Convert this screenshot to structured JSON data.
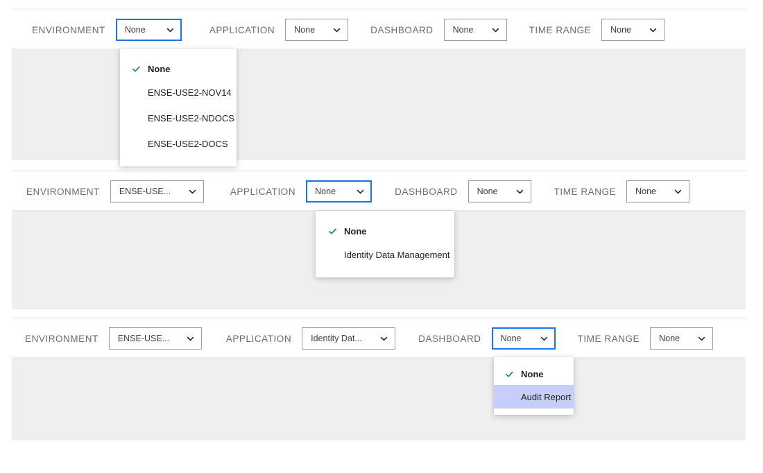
{
  "labels": {
    "environment": "ENVIRONMENT",
    "application": "APPLICATION",
    "dashboard": "DASHBOARD",
    "time_range": "TIME RANGE"
  },
  "icons": {
    "caret": "chevron-down-icon",
    "check": "check-icon"
  },
  "colors": {
    "focus_border": "#1a73e8",
    "check_green": "#0b8043",
    "highlight": "#c6cffa",
    "canvas_bg": "#efefef",
    "border": "#9a9a9a",
    "label_text": "#6b6b6b"
  },
  "sections": [
    {
      "id": "section-1",
      "selects": {
        "environment": {
          "value": "None",
          "focused": true
        },
        "application": {
          "value": "None",
          "focused": false
        },
        "dashboard": {
          "value": "None",
          "focused": false
        },
        "time_range": {
          "value": "None",
          "focused": false
        }
      },
      "open_dropdown": {
        "owner": "environment",
        "items": [
          {
            "label": "None",
            "selected": true,
            "highlighted": false
          },
          {
            "label": "ENSE-USE2-NOV14",
            "selected": false,
            "highlighted": false
          },
          {
            "label": "ENSE-USE2-NDOCS",
            "selected": false,
            "highlighted": false
          },
          {
            "label": "ENSE-USE2-DOCS",
            "selected": false,
            "highlighted": false
          }
        ]
      }
    },
    {
      "id": "section-2",
      "selects": {
        "environment": {
          "value": "ENSE-USE...",
          "focused": false
        },
        "application": {
          "value": "None",
          "focused": true
        },
        "dashboard": {
          "value": "None",
          "focused": false
        },
        "time_range": {
          "value": "None",
          "focused": false
        }
      },
      "open_dropdown": {
        "owner": "application",
        "items": [
          {
            "label": "None",
            "selected": true,
            "highlighted": false
          },
          {
            "label": "Identity Data Management",
            "selected": false,
            "highlighted": false
          }
        ]
      }
    },
    {
      "id": "section-3",
      "selects": {
        "environment": {
          "value": "ENSE-USE...",
          "focused": false
        },
        "application": {
          "value": "Identity Dat...",
          "focused": false
        },
        "dashboard": {
          "value": "None",
          "focused": true
        },
        "time_range": {
          "value": "None",
          "focused": false
        }
      },
      "open_dropdown": {
        "owner": "dashboard",
        "items": [
          {
            "label": "None",
            "selected": true,
            "highlighted": false
          },
          {
            "label": "Audit Report",
            "selected": false,
            "highlighted": true
          }
        ]
      }
    }
  ]
}
